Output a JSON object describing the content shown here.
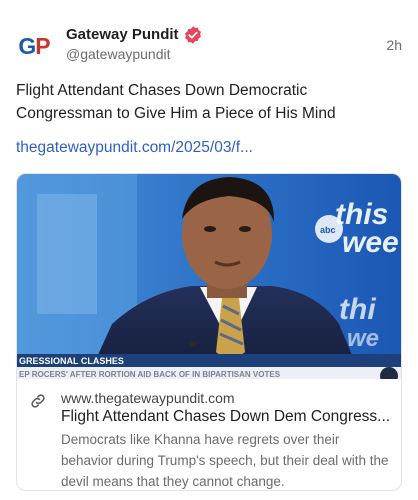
{
  "post": {
    "author": {
      "name": "Gateway Pundit",
      "handle": "@gatewaypundit",
      "avatar_text_g": "G",
      "avatar_text_p": "P",
      "verified": true
    },
    "timestamp": "2h",
    "text": "Flight Attendant Chases Down Democratic Congressman to Give Him a Piece of His Mind",
    "link_text": "thegatewaypundit.com/2025/03/f..."
  },
  "card": {
    "image": {
      "ticker_left": "GRESSIONAL CLASHES",
      "ticker_bottom": "EP ROCERS' AFTER RORTION AID BACK OF IN BIPARTISAN VOTES",
      "show_logo": "this week",
      "network": "abc"
    },
    "domain": "www.thegatewaypundit.com",
    "title": "Flight Attendant Chases Down Dem Congress...",
    "description": "Democrats like Khanna have regrets over their behavior during Trump's speech, but their deal with the devil means that they cannot change."
  },
  "colors": {
    "brand_blue": "#1b5ba8",
    "brand_red": "#c6362c",
    "link_blue": "#2f5fc4",
    "verified_badge": "#e8455a"
  }
}
